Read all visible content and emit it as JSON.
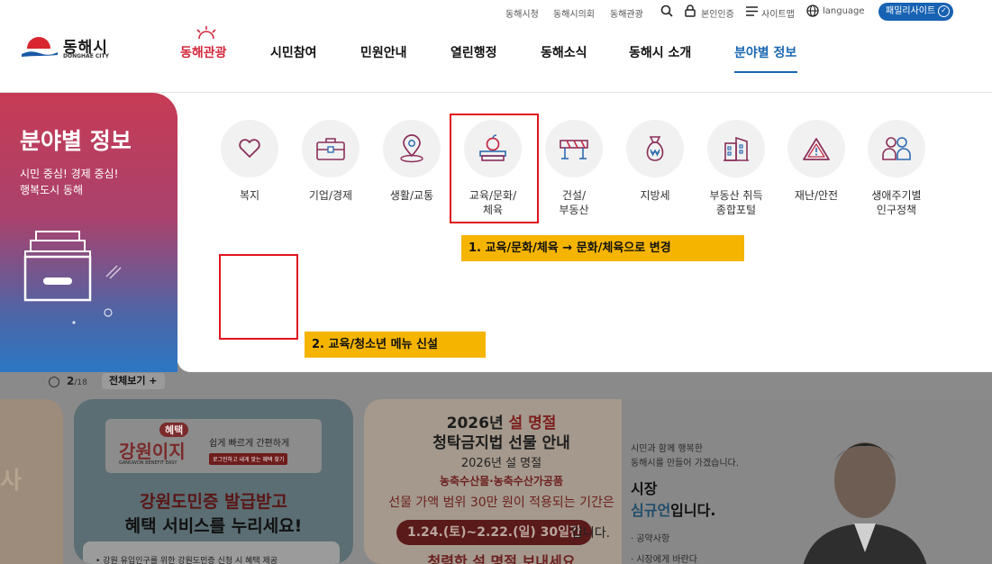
{
  "utility": {
    "links": [
      "동해시청",
      "동해시의회",
      "동해관광"
    ],
    "auth": "본인인증",
    "sitemap": "사이트맵",
    "language": "language",
    "family_sites": "패밀리사이트"
  },
  "logo": {
    "ko": "동해시",
    "en": "DONGHAE CITY"
  },
  "gnb": {
    "items": [
      "동해관광",
      "시민참여",
      "민원안내",
      "열린행정",
      "동해소식",
      "동해시 소개",
      "분야별 정보"
    ],
    "active": "분야별 정보"
  },
  "mega": {
    "title": "분야별 정보",
    "subtitle_1": "시민 중심! 경제 중심!",
    "subtitle_2": "행복도시 동해",
    "categories": [
      {
        "label": "복지",
        "icon": "heart-icon"
      },
      {
        "label": "기업/경제",
        "icon": "briefcase-icon"
      },
      {
        "label": "생활/교통",
        "icon": "map-pin-icon"
      },
      {
        "label": "교육/문화/\n체육",
        "icon": "apple-books-icon"
      },
      {
        "label": "건설/\n부동산",
        "icon": "barrier-icon"
      },
      {
        "label": "지방세",
        "icon": "money-bag-icon"
      },
      {
        "label": "부동산 취득\n종합포털",
        "icon": "building-icon"
      },
      {
        "label": "재난/안전",
        "icon": "warning-icon"
      },
      {
        "label": "생애주기별\n인구정책",
        "icon": "people-icon"
      }
    ]
  },
  "annotations": {
    "note_1": "1. 교육/문화/체육 → 문화/체육으로 변경",
    "note_2": "2. 교육/청소년 메뉴 신설"
  },
  "slider": {
    "current": "2",
    "total": "/18",
    "view_all": "전체보기 +"
  },
  "banner_left": {
    "text": "사"
  },
  "banner_gangwon": {
    "badge": "혜택",
    "logo": "강원이지",
    "logo_sub": "GANGWON BENEFIT EASY",
    "tagline": "쉽게 빠르게 간편하게",
    "button": "로그인하고 내게 맞는 혜택 찾기",
    "headline_1": "강원도민증 발급받고",
    "headline_2": "혜택 서비스를 누리세요!",
    "bottom": "• 강원 유입인구를 위한 강원도민증 신청 시 혜택 제공"
  },
  "banner_holiday": {
    "line1_a": "2026년",
    "line1_b": "설 명절",
    "line2": "청탁금지법 선물 안내",
    "line3": "2026년 설 명절",
    "line4": "농축수산물·농축수산가공품",
    "line5": "선물 가액 범위 30만 원이 적용되는 기간은",
    "period": "1.24.(토)~2.22.(일) 30일간",
    "period_suffix": "입니다.",
    "line7": "청렴한 설 명절 보내세요"
  },
  "mayor": {
    "line1": "시민과 함께 행복한",
    "line2": "동해시를 만들어 가겠습니다.",
    "title": "시장",
    "name": "심규언",
    "name_suffix": "입니다.",
    "link1": "· 공약사항",
    "link2": "· 시장에게 바란다"
  },
  "colors": {
    "accent_blue": "#1a67b1",
    "tour_red": "#d2273c",
    "annotation_red": "#e0141e",
    "note_yellow": "#f5b400"
  }
}
